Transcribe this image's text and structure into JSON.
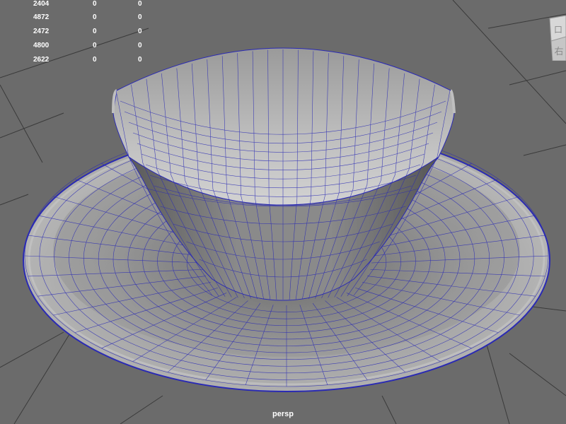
{
  "viewport": {
    "camera_label": "persp",
    "background_color": "#6b6b6b",
    "wireframe_color": "#2a2ab4",
    "grid_color": "#3a3a3a"
  },
  "hud_stats": {
    "rows": [
      {
        "value": "2404",
        "col2": "0",
        "col3": "0"
      },
      {
        "value": "4872",
        "col2": "0",
        "col3": "0"
      },
      {
        "value": "2472",
        "col2": "0",
        "col3": "0"
      },
      {
        "value": "4800",
        "col2": "0",
        "col3": "0"
      },
      {
        "value": "2622",
        "col2": "0",
        "col3": "0"
      }
    ]
  },
  "view_cube": {
    "face_top": "口",
    "face_right": "右"
  },
  "scene": {
    "objects": [
      "cup",
      "saucer"
    ],
    "display_mode": "smooth shaded with wireframe"
  }
}
